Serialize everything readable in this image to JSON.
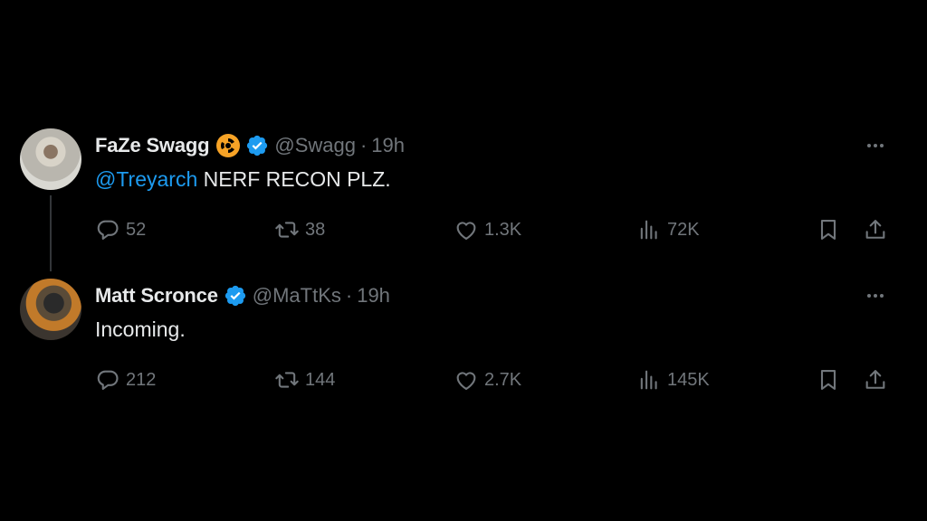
{
  "colors": {
    "background": "#000000",
    "text_primary": "#e7e9ea",
    "text_secondary": "#71767b",
    "accent": "#1d9bf0",
    "faze_badge": "#f7a326"
  },
  "tweets": [
    {
      "display_name": "FaZe Swagg",
      "affiliate_badge_icon": "faze-clan-badge-icon",
      "verified_icon": "verified-badge-icon",
      "handle": "@Swagg",
      "separator": "·",
      "time": "19h",
      "mention": "@Treyarch",
      "text": " NERF RECON PLZ.",
      "replies": "52",
      "retweets": "38",
      "likes": "1.3K",
      "views": "72K"
    },
    {
      "display_name": "Matt Scronce",
      "verified_icon": "verified-badge-icon",
      "handle": "@MaTtKs",
      "separator": "·",
      "time": "19h",
      "text": "Incoming.",
      "replies": "212",
      "retweets": "144",
      "likes": "2.7K",
      "views": "145K"
    }
  ]
}
